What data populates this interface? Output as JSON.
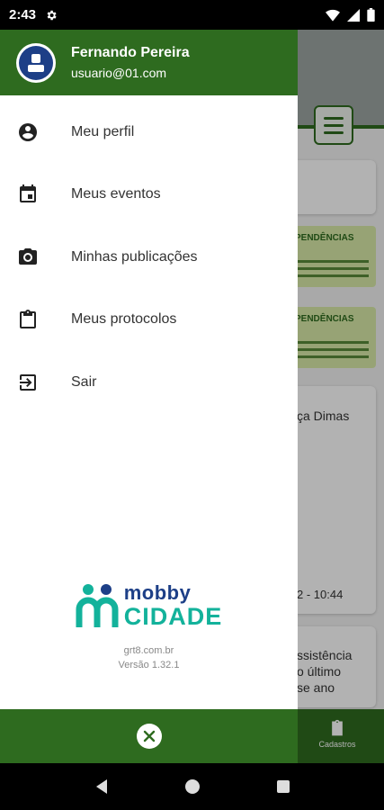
{
  "status_bar": {
    "time": "2:43"
  },
  "drawer": {
    "user": {
      "name": "Fernando Pereira",
      "email": "usuario@01.com"
    },
    "menu": [
      {
        "label": "Meu perfil",
        "icon": "account-circle-icon"
      },
      {
        "label": "Meus eventos",
        "icon": "calendar-icon"
      },
      {
        "label": "Minhas publicações",
        "icon": "camera-icon"
      },
      {
        "label": "Meus protocolos",
        "icon": "clipboard-icon"
      },
      {
        "label": "Sair",
        "icon": "logout-icon"
      }
    ],
    "brand": {
      "line1": "mobby",
      "line2": "CIDADE",
      "site": "grt8.com.br",
      "version": "Versão 1.32.1"
    }
  },
  "background": {
    "banner_title": "PENDÊNCIAS",
    "card_text_1": "ça Dimas",
    "card_time": "2 - 10:44",
    "card_text_2_l1": "ssistência",
    "card_text_2_l2": "o último",
    "card_text_2_l3": "se ano",
    "bottom_nav_label": "Cadastros"
  },
  "colors": {
    "brand_green": "#2e6b1f",
    "brand_blue": "#1d3f87",
    "brand_teal": "#13b29b"
  }
}
